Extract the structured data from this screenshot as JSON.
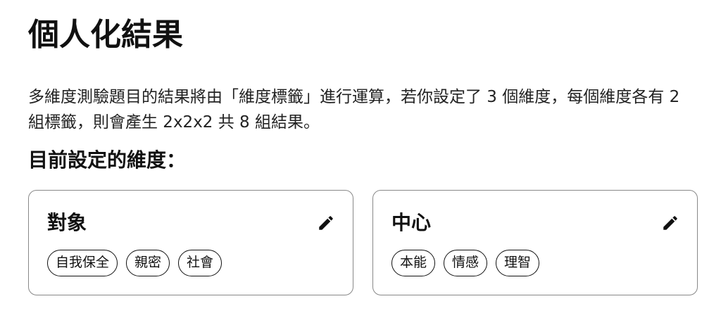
{
  "page": {
    "title": "個人化結果",
    "description": "多維度測驗題目的結果將由「維度標籤」進行運算，若你設定了 3 個維度，每個維度各有 2 組標籤，則會產生 2x2x2 共 8 組結果。",
    "section_title": "目前設定的維度："
  },
  "dimensions": [
    {
      "name": "對象",
      "edit_icon": "pencil-icon",
      "tags": [
        "自我保全",
        "親密",
        "社會"
      ]
    },
    {
      "name": "中心",
      "edit_icon": "pencil-icon",
      "tags": [
        "本能",
        "情感",
        "理智"
      ]
    }
  ]
}
